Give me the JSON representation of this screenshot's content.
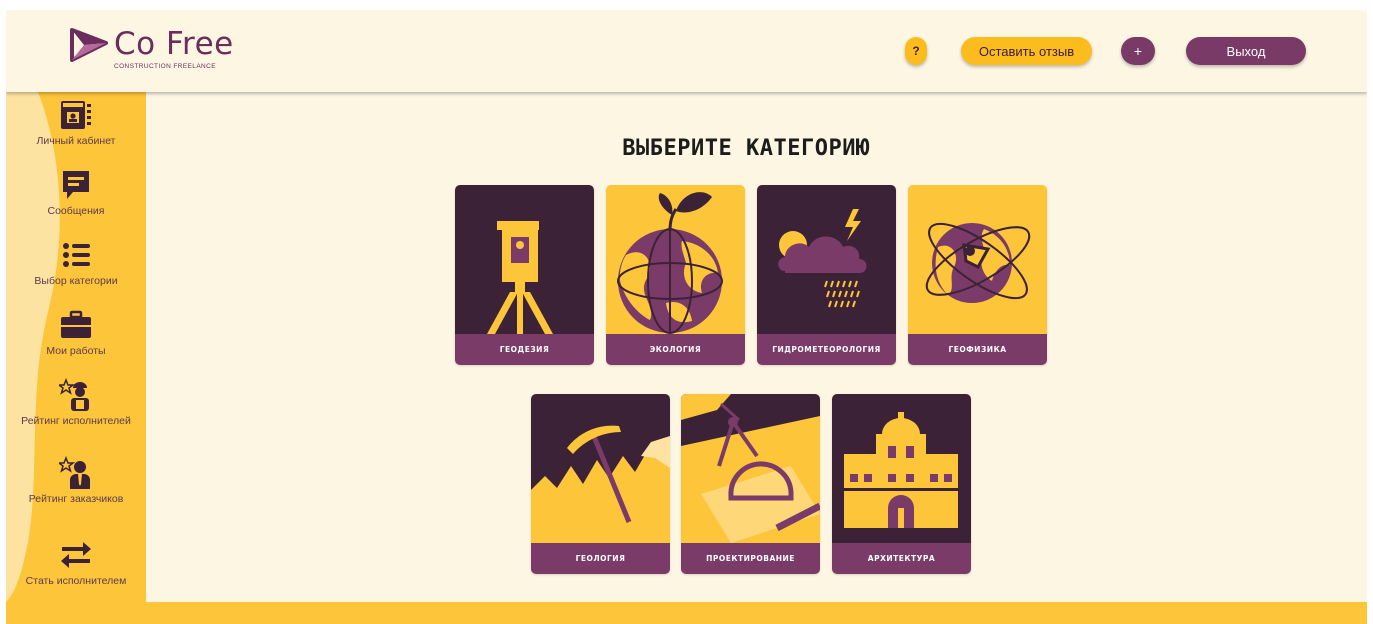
{
  "logo": {
    "name": "Co Free",
    "tagline": "CONSTRUCTION FREELANCE"
  },
  "header": {
    "help_label": "?",
    "review_label": "Оставить отзыв",
    "add_label": "+",
    "logout_label": "Выход"
  },
  "sidebar": {
    "items": [
      {
        "label": "Личный кабинет",
        "icon": "profile-card-icon"
      },
      {
        "label": "Сообщения",
        "icon": "chat-message-icon"
      },
      {
        "label": "Выбор категории",
        "icon": "list-icon"
      },
      {
        "label": "Мои работы",
        "icon": "briefcase-icon"
      },
      {
        "label": "Рейтинг исполнителей",
        "icon": "worker-rating-icon"
      },
      {
        "label": "Рейтинг заказчиков",
        "icon": "customer-rating-icon"
      },
      {
        "label": "Стать исполнителем",
        "icon": "swap-arrows-icon"
      }
    ]
  },
  "main": {
    "title": "ВЫБЕРИТЕ КАТЕГОРИЮ",
    "categories": [
      {
        "label": "ГЕОДЕЗИЯ",
        "icon": "theodolite-icon"
      },
      {
        "label": "ЭКОЛОГИЯ",
        "icon": "globe-sprout-icon"
      },
      {
        "label": "ГИДРОМЕТЕОРОЛОГИЯ",
        "icon": "storm-cloud-icon"
      },
      {
        "label": "ГЕОФИЗИКА",
        "icon": "globe-orbit-icon"
      },
      {
        "label": "ГЕОЛОГИЯ",
        "icon": "pickaxe-mountains-icon"
      },
      {
        "label": "ПРОЕКТИРОВАНИЕ",
        "icon": "drafting-tools-icon"
      },
      {
        "label": "АРХИТЕКТУРА",
        "icon": "building-icon"
      }
    ]
  },
  "colors": {
    "accent_yellow": "#fdc53a",
    "accent_purple": "#7b3b69",
    "dark_plum": "#3b2236",
    "background": "#fdf6e3"
  }
}
